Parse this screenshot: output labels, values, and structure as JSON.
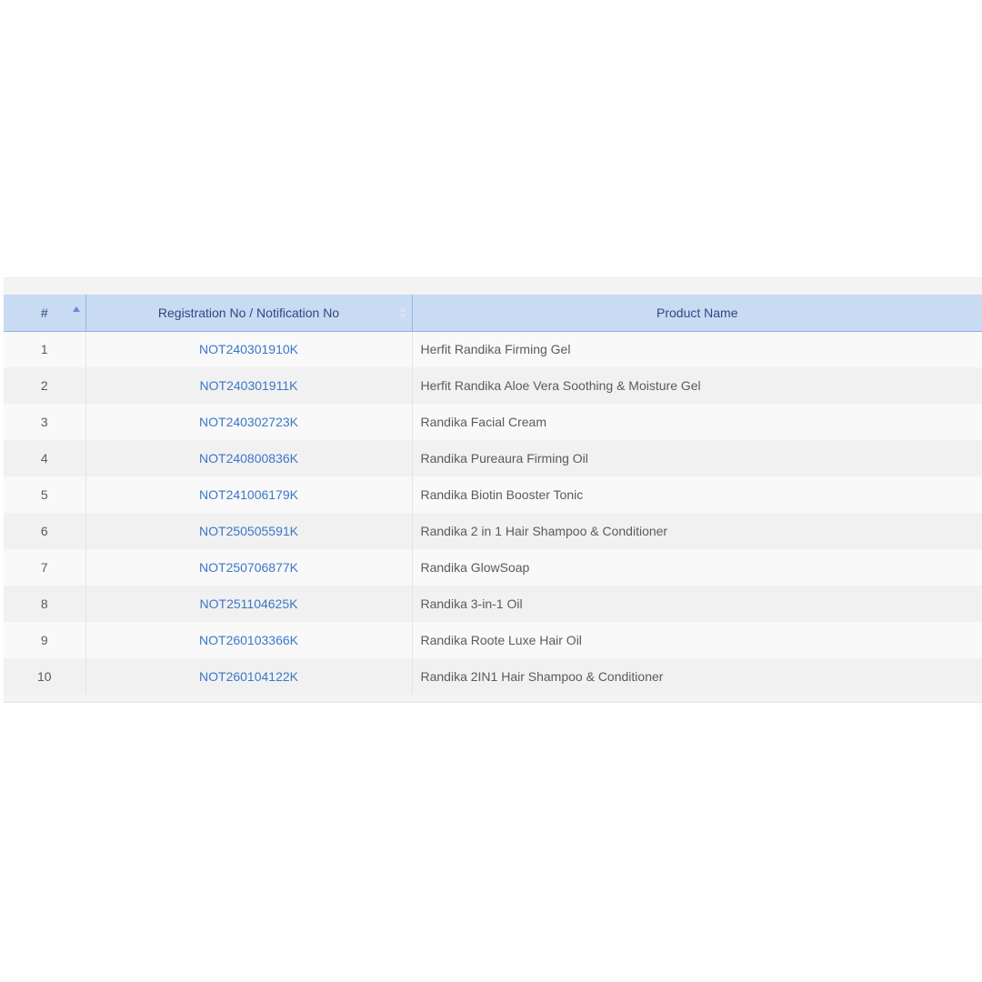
{
  "table": {
    "headers": {
      "num": "#",
      "reg": "Registration No / Notification No",
      "name": "Product Name"
    },
    "rows": [
      {
        "num": "1",
        "reg": "NOT240301910K",
        "name": "Herfit Randika Firming Gel"
      },
      {
        "num": "2",
        "reg": "NOT240301911K",
        "name": "Herfit Randika Aloe Vera Soothing & Moisture Gel"
      },
      {
        "num": "3",
        "reg": "NOT240302723K",
        "name": "Randika Facial Cream"
      },
      {
        "num": "4",
        "reg": "NOT240800836K",
        "name": "Randika Pureaura Firming Oil"
      },
      {
        "num": "5",
        "reg": "NOT241006179K",
        "name": "Randika Biotin Booster Tonic"
      },
      {
        "num": "6",
        "reg": "NOT250505591K",
        "name": "Randika 2 in 1 Hair Shampoo & Conditioner"
      },
      {
        "num": "7",
        "reg": "NOT250706877K",
        "name": "Randika GlowSoap"
      },
      {
        "num": "8",
        "reg": "NOT251104625K",
        "name": "Randika 3-in-1 Oil"
      },
      {
        "num": "9",
        "reg": "NOT260103366K",
        "name": "Randika Roote Luxe Hair Oil"
      },
      {
        "num": "10",
        "reg": "NOT260104122K",
        "name": "Randika 2IN1 Hair Shampoo & Conditioner"
      }
    ]
  },
  "icons": {
    "num_sort": "sort-ascending-icon",
    "reg_sort": "sort-both-icon"
  },
  "colors": {
    "header_bg": "#c9daf3",
    "header_text": "#2b4a82",
    "link": "#3a78c9"
  }
}
